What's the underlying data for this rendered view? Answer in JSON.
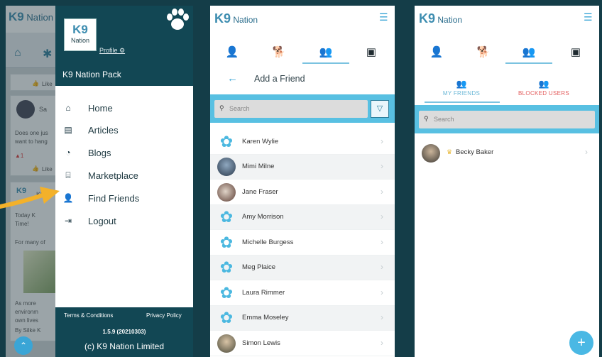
{
  "screen1": {
    "logo": {
      "mark": "K9",
      "text": "Nation"
    },
    "drawer": {
      "logo_mark": "K9",
      "logo_text": "Nation",
      "profile_link": "Profile ⚙",
      "pack_title": "K9 Nation Pack",
      "menu": [
        {
          "label": "Home",
          "icon": "home-icon"
        },
        {
          "label": "Articles",
          "icon": "articles-icon"
        },
        {
          "label": "Blogs",
          "icon": "rss-icon"
        },
        {
          "label": "Marketplace",
          "icon": "basket-icon"
        },
        {
          "label": "Find Friends",
          "icon": "add-user-icon"
        },
        {
          "label": "Logout",
          "icon": "logout-icon"
        }
      ],
      "terms": "Terms & Conditions",
      "privacy": "Privacy Policy",
      "version": "1.5.9 (20210303)",
      "copyright": "(c) K9 Nation Limited"
    },
    "feed": {
      "card1_like": "Like",
      "card2_name": "Sa",
      "card2_text": "Does one jus",
      "card2_text2": "want to hang",
      "card2_counts": "1",
      "card3_name": "K9",
      "card3_text": "Today K",
      "card3_text2": "Time!",
      "card3_text3": "For many of",
      "card4_text": "As more",
      "card4_text2": "environm",
      "card4_text3": "own lives",
      "card4_by": "By Silke K"
    }
  },
  "screen2": {
    "logo": {
      "mark": "K9",
      "text": "Nation"
    },
    "title": "Add a Friend",
    "search_placeholder": "Search",
    "friends": [
      {
        "name": "Karen Wylie",
        "avatar": "paw"
      },
      {
        "name": "Mimi Milne",
        "avatar": "photo1"
      },
      {
        "name": "Jane Fraser",
        "avatar": "photo2"
      },
      {
        "name": "Amy Morrison",
        "avatar": "paw"
      },
      {
        "name": "Michelle Burgess",
        "avatar": "paw"
      },
      {
        "name": "Meg Plaice",
        "avatar": "paw"
      },
      {
        "name": "Laura Rimmer",
        "avatar": "paw"
      },
      {
        "name": "Emma Moseley",
        "avatar": "paw"
      },
      {
        "name": "Simon Lewis",
        "avatar": "photo3"
      }
    ]
  },
  "screen3": {
    "logo": {
      "mark": "K9",
      "text": "Nation"
    },
    "seg_my_friends": "MY FRIENDS",
    "seg_blocked": "BLOCKED USERS",
    "search_placeholder": "Search",
    "friend": {
      "name": "Becky Baker"
    },
    "fab": "+"
  },
  "colors": {
    "accent": "#3aa5d6",
    "dark": "#124754",
    "arrow": "#f3b12a",
    "blocked": "#e35c5c"
  }
}
